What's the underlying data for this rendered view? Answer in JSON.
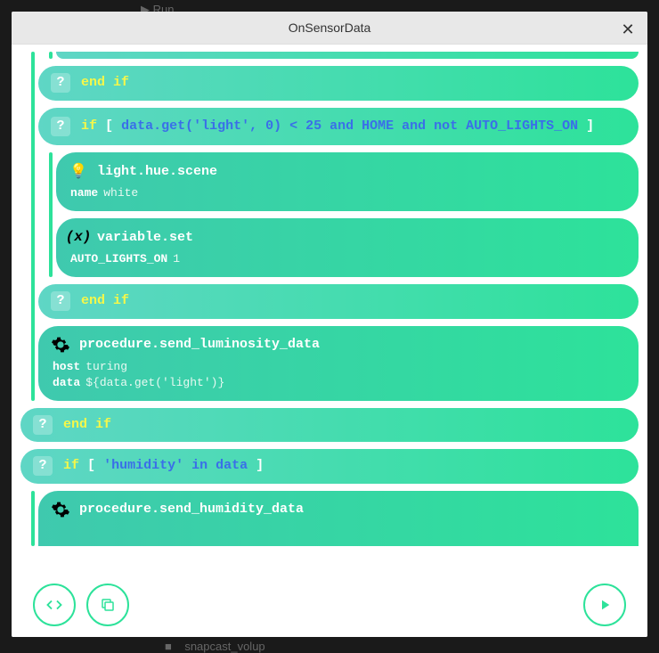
{
  "header": {
    "title": "OnSensorData"
  },
  "bg": {
    "run": "Run",
    "snap": "snapcast_volup"
  },
  "blocks": {
    "endif1": {
      "kw": "end if"
    },
    "if1": {
      "kw_if": "if",
      "br_open": "[",
      "expr": "data.get('light', 0) < 25 and HOME and not AUTO_LIGHTS_ON",
      "br_close": "]"
    },
    "hue": {
      "title": "light.hue.scene",
      "p1k": "name",
      "p1v": "white"
    },
    "varset": {
      "title": "variable.set",
      "p1k": "AUTO_LIGHTS_ON",
      "p1v": "1"
    },
    "endif2": {
      "kw": "end if"
    },
    "proc_lum": {
      "title": "procedure.send_luminosity_data",
      "p1k": "host",
      "p1v": "turing",
      "p2k": "data",
      "p2v": "${data.get('light')}"
    },
    "endif3": {
      "kw": "end if"
    },
    "if2": {
      "kw_if": "if",
      "br_open": "[",
      "expr": "'humidity' in data",
      "br_close": "]"
    },
    "proc_hum": {
      "title": "procedure.send_humidity_data"
    }
  }
}
